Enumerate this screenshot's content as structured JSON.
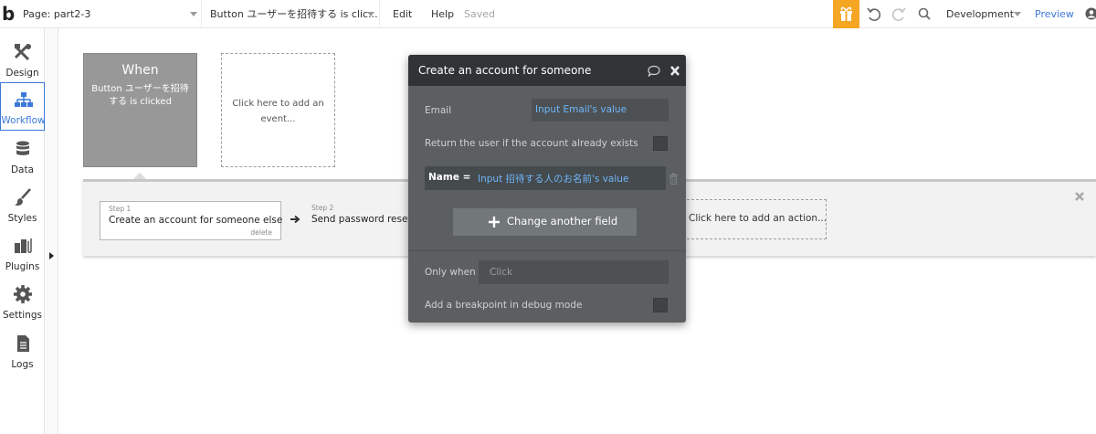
{
  "topbar": {
    "logo": "b",
    "page_label": "Page: part2-3",
    "event_label": "Button ユーザーを招待する is clic...",
    "edit": "Edit",
    "help": "Help",
    "saved": "Saved",
    "environment": "Development",
    "preview": "Preview"
  },
  "sidebar": {
    "items": [
      {
        "label": "Design",
        "icon": "design-icon"
      },
      {
        "label": "Workflow",
        "icon": "workflow-icon",
        "active": true
      },
      {
        "label": "Data",
        "icon": "database-icon"
      },
      {
        "label": "Styles",
        "icon": "brush-icon"
      },
      {
        "label": "Plugins",
        "icon": "plug-icon"
      },
      {
        "label": "Settings",
        "icon": "gear-icon"
      },
      {
        "label": "Logs",
        "icon": "document-icon"
      }
    ]
  },
  "canvas": {
    "when_title": "When",
    "when_subtitle": "Button ユーザーを招待する is clicked",
    "add_event": "Click here to add an event...",
    "steps": [
      {
        "num": "Step 1",
        "title": "Create an account for someone else",
        "delete": "delete"
      },
      {
        "num": "Step 2",
        "title": "Send password reset"
      }
    ],
    "add_action": "Click here to add an action..."
  },
  "modal": {
    "title": "Create an account for someone el",
    "email_label": "Email",
    "email_value": "Input Email's value",
    "return_label": "Return the user if the account already exists",
    "name_label": "Name  =",
    "name_value": "Input 招待する人のお名前's value",
    "change_button": "Change another field",
    "only_when_label": "Only when",
    "only_when_placeholder": "Click",
    "breakpoint_label": "Add a breakpoint in debug mode"
  },
  "colors": {
    "accent_blue": "#3c78d8",
    "gift_orange": "#f5a623",
    "modal_bg": "#5b5f62",
    "modal_header": "#303437",
    "dynamic_value": "#6fb5f7"
  }
}
